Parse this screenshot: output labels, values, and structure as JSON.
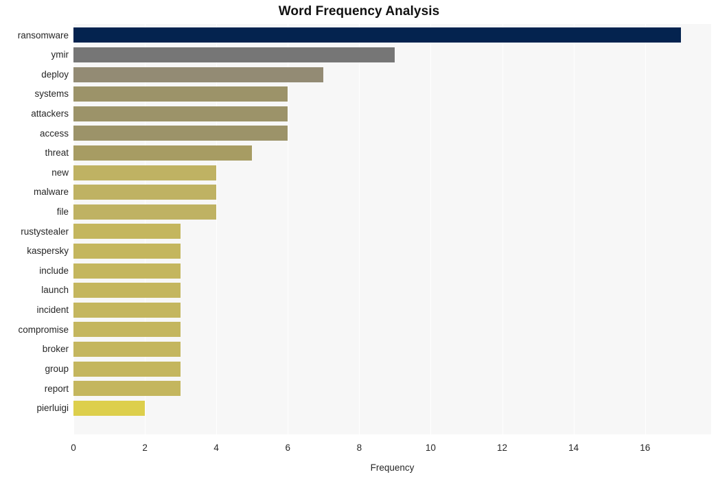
{
  "chart_data": {
    "type": "bar",
    "orientation": "horizontal",
    "title": "Word Frequency Analysis",
    "xlabel": "Frequency",
    "ylabel": "",
    "categories": [
      "ransomware",
      "ymir",
      "deploy",
      "systems",
      "attackers",
      "access",
      "threat",
      "new",
      "malware",
      "file",
      "rustystealer",
      "kaspersky",
      "include",
      "launch",
      "incident",
      "compromise",
      "broker",
      "group",
      "report",
      "pierluigi"
    ],
    "values": [
      17,
      9,
      7,
      6,
      6,
      6,
      5,
      4,
      4,
      4,
      3,
      3,
      3,
      3,
      3,
      3,
      3,
      3,
      3,
      2
    ],
    "bar_colors": [
      "#04234f",
      "#767676",
      "#938b74",
      "#9c9369",
      "#9c9369",
      "#9c9369",
      "#a79c63",
      "#bfb263",
      "#bfb263",
      "#bfb263",
      "#c4b65e",
      "#c4b65e",
      "#c4b65e",
      "#c4b65e",
      "#c4b65e",
      "#c4b65e",
      "#c4b65e",
      "#c4b65e",
      "#c4b65e",
      "#ddcf4c"
    ],
    "xlim": [
      0,
      17.85
    ],
    "xticks": [
      0,
      2,
      4,
      6,
      8,
      10,
      12,
      14,
      16
    ],
    "xticklabels": [
      "0",
      "2",
      "4",
      "6",
      "8",
      "10",
      "12",
      "14",
      "16"
    ],
    "grid": true,
    "grid_axis": "x",
    "grid_color": "#ffffff",
    "plot_background": "#f7f7f7",
    "figure_background": "#ffffff",
    "legend": null,
    "data_labels": false
  }
}
